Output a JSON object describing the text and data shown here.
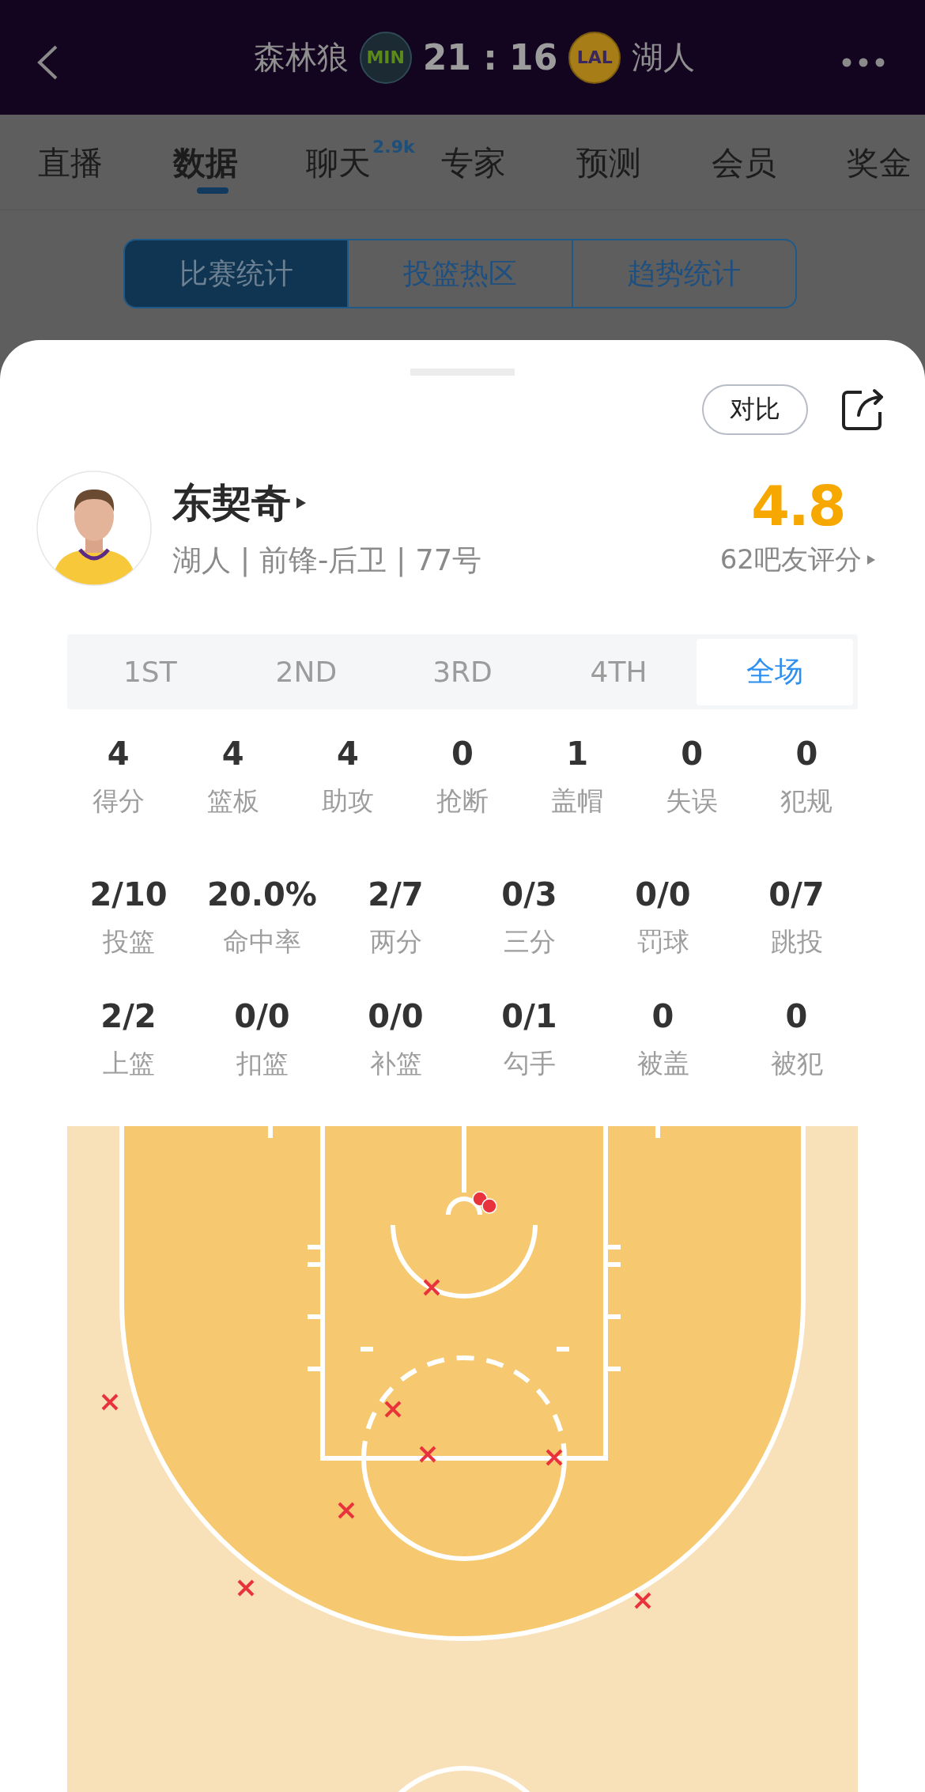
{
  "header": {
    "home_team": {
      "name": "森林狼",
      "logo_text": "MIN"
    },
    "score": "21 : 16",
    "away_team": {
      "name": "湖人",
      "logo_text": "LAL"
    }
  },
  "tabs": [
    {
      "label": "直播",
      "selected": false
    },
    {
      "label": "数据",
      "selected": true
    },
    {
      "label": "聊天",
      "badge": "2.9k",
      "selected": false
    },
    {
      "label": "专家",
      "selected": false
    },
    {
      "label": "预测",
      "selected": false
    },
    {
      "label": "会员",
      "selected": false
    },
    {
      "label": "奖金",
      "selected": false
    }
  ],
  "segments": [
    {
      "label": "比赛统计",
      "selected": true
    },
    {
      "label": "投篮热区",
      "selected": false
    },
    {
      "label": "趋势统计",
      "selected": false
    }
  ],
  "sheet": {
    "compare_button": "对比",
    "player": {
      "name": "东契奇",
      "info": "湖人 | 前锋-后卫 | 77号",
      "rating": "4.8",
      "rating_count": "62吧友评分"
    },
    "periods": [
      {
        "label": "1ST",
        "selected": false
      },
      {
        "label": "2ND",
        "selected": false
      },
      {
        "label": "3RD",
        "selected": false
      },
      {
        "label": "4TH",
        "selected": false
      },
      {
        "label": "全场",
        "selected": true
      }
    ],
    "stat_rows": [
      [
        {
          "value": "4",
          "label": "得分"
        },
        {
          "value": "4",
          "label": "篮板"
        },
        {
          "value": "4",
          "label": "助攻"
        },
        {
          "value": "0",
          "label": "抢断"
        },
        {
          "value": "1",
          "label": "盖帽"
        },
        {
          "value": "0",
          "label": "失误"
        },
        {
          "value": "0",
          "label": "犯规"
        }
      ],
      [
        {
          "value": "2/10",
          "label": "投篮"
        },
        {
          "value": "20.0%",
          "label": "命中率"
        },
        {
          "value": "2/7",
          "label": "两分"
        },
        {
          "value": "0/3",
          "label": "三分"
        },
        {
          "value": "0/0",
          "label": "罚球"
        },
        {
          "value": "0/7",
          "label": "跳投"
        }
      ],
      [
        {
          "value": "2/2",
          "label": "上篮"
        },
        {
          "value": "0/0",
          "label": "扣篮"
        },
        {
          "value": "0/0",
          "label": "补篮"
        },
        {
          "value": "0/1",
          "label": "勾手"
        },
        {
          "value": "0",
          "label": "被盖"
        },
        {
          "value": "0",
          "label": "被犯"
        }
      ]
    ],
    "shot_chart": {
      "shots": [
        {
          "made": true
        },
        {
          "made": true
        },
        {
          "made": false
        },
        {
          "made": false
        },
        {
          "made": false
        },
        {
          "made": false
        },
        {
          "made": false
        },
        {
          "made": false
        },
        {
          "made": false
        },
        {
          "made": false
        }
      ]
    }
  }
}
